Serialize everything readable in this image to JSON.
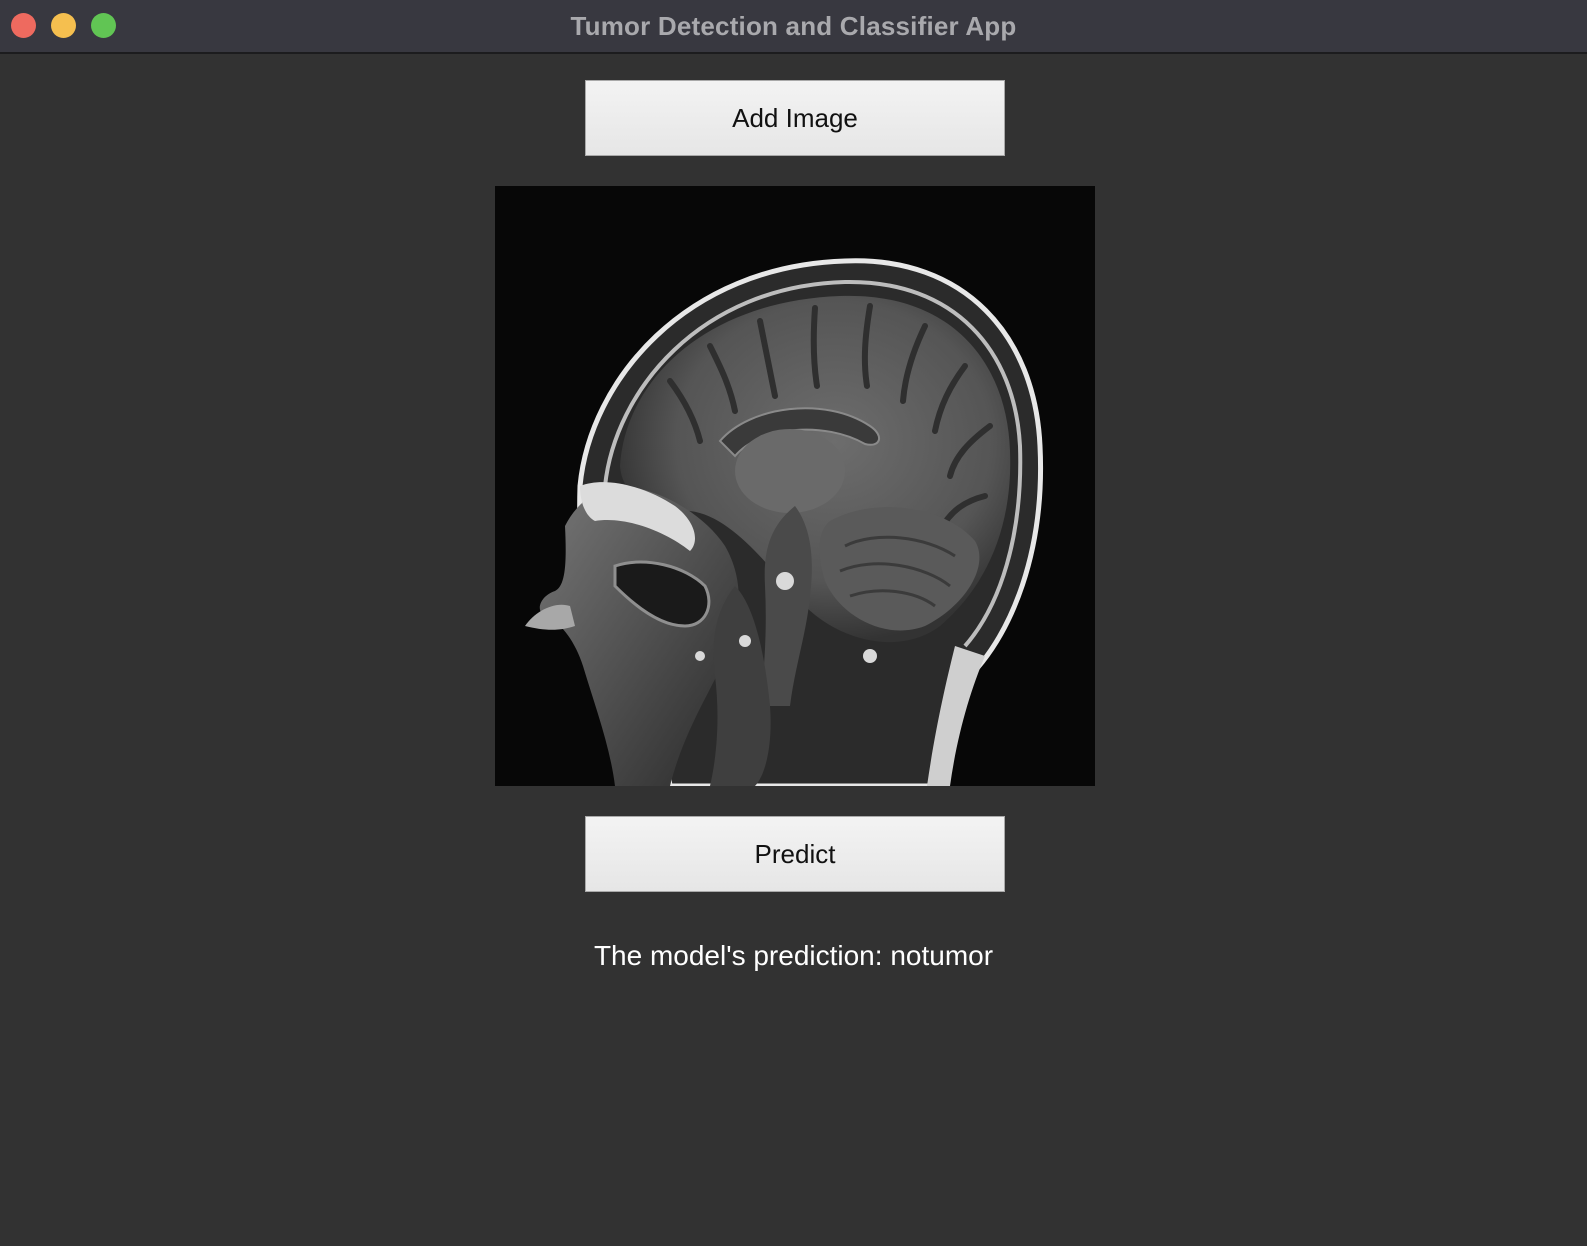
{
  "window": {
    "title": "Tumor Detection and Classifier App",
    "controls": {
      "close_color": "#ee6a5f",
      "minimize_color": "#f5bf4f",
      "zoom_color": "#61c554"
    }
  },
  "main": {
    "add_image_label": "Add Image",
    "predict_label": "Predict",
    "prediction_text": "The model's prediction: notumor",
    "image": {
      "description_icon": "sagittal-brain-mri-image"
    }
  },
  "colors": {
    "background": "#323232",
    "titlebar": "#383840",
    "button": "#eeeeee",
    "text": "#ffffff"
  }
}
